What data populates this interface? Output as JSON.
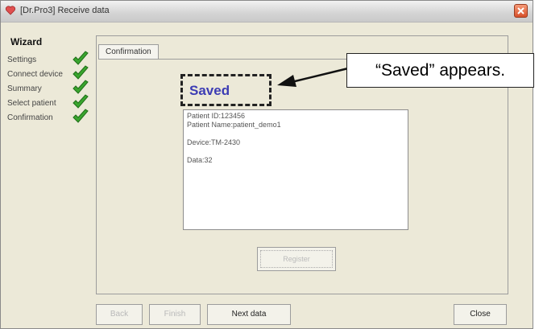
{
  "window": {
    "title": "[Dr.Pro3] Receive data"
  },
  "wizard": {
    "title": "Wizard",
    "steps": [
      {
        "label": "Settings",
        "done": true
      },
      {
        "label": "Connect device",
        "done": true
      },
      {
        "label": "Summary",
        "done": true
      },
      {
        "label": "Select patient",
        "done": true
      },
      {
        "label": "Confirmation",
        "done": true
      }
    ]
  },
  "panel": {
    "tab_label": "Confirmation",
    "status_text": "Saved",
    "info_lines": {
      "patient_id": "Patient ID:123456",
      "patient_name": "Patient Name:patient_demo1",
      "device": "Device:TM-2430",
      "data": "Data:32"
    },
    "register_label": "Register"
  },
  "buttons": {
    "back": "Back",
    "finish": "Finish",
    "next_data": "Next data",
    "close": "Close"
  },
  "annotation": {
    "callout_text": "“Saved” appears."
  },
  "colors": {
    "saved_text": "#3c3cb4",
    "checkmark": "#3aa52f",
    "close_button": "#d7502a"
  }
}
